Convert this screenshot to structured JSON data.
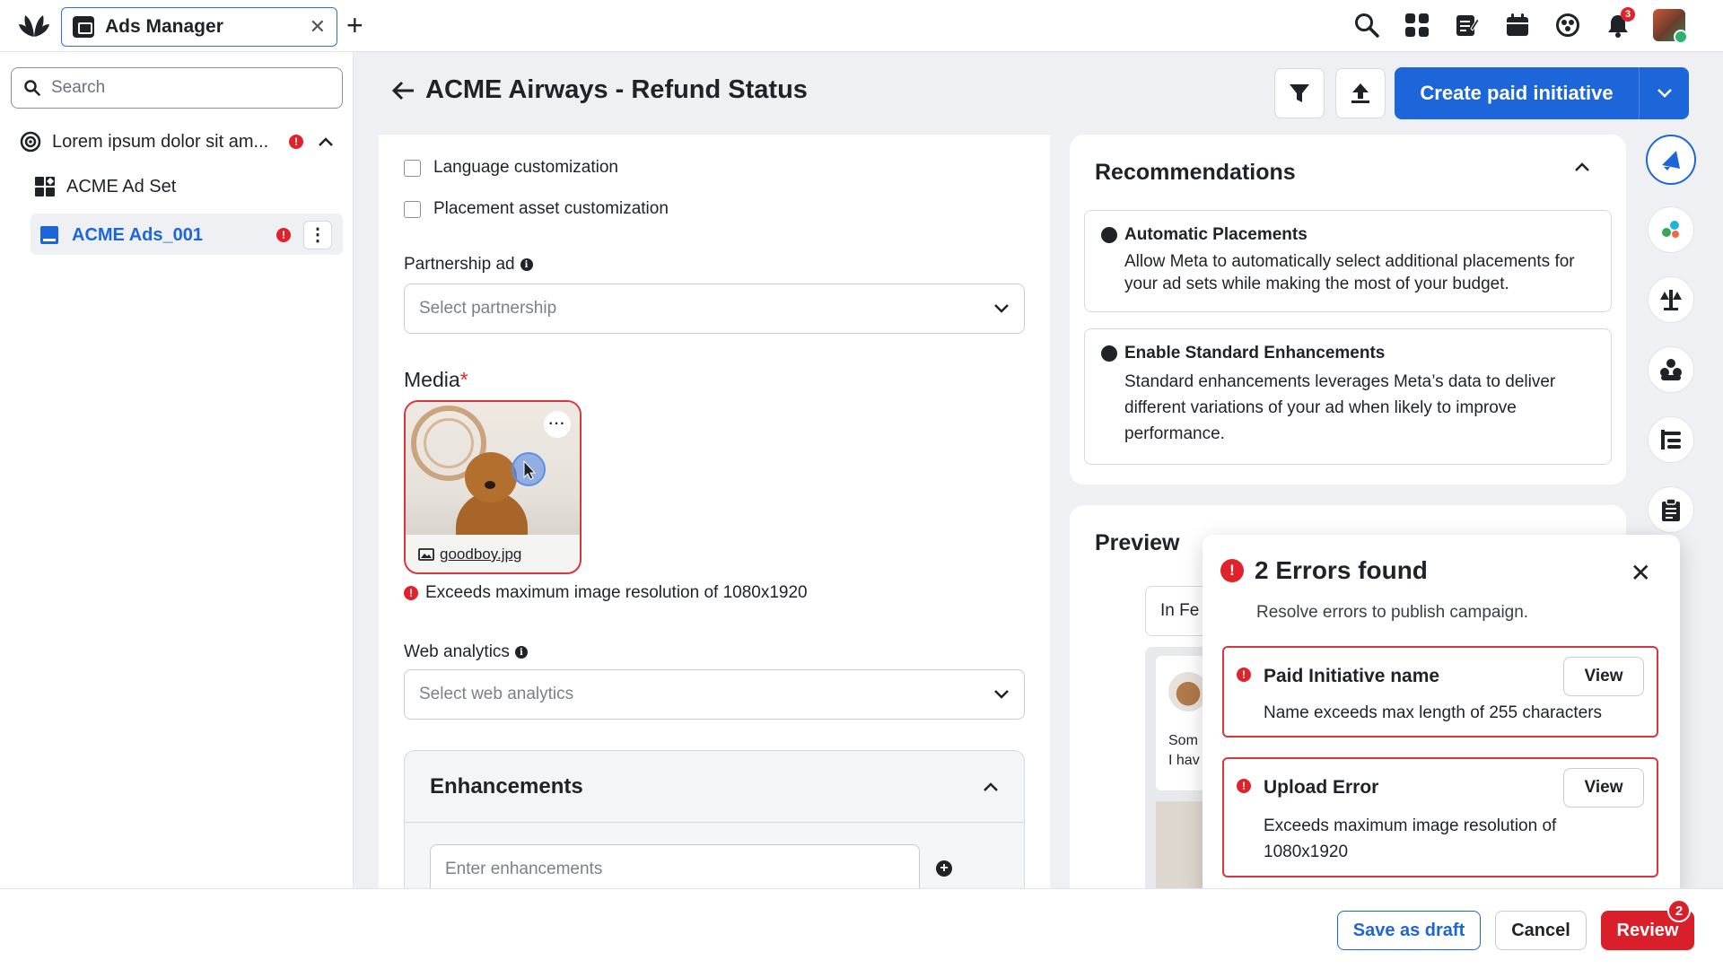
{
  "tab": {
    "title": "Ads Manager"
  },
  "topbar": {
    "notifications_count": "3"
  },
  "sidebar": {
    "search_placeholder": "Search",
    "campaign": "Lorem ipsum dolor sit am...",
    "ad_set": "ACME Ad Set",
    "ad": "ACME Ads_001",
    "error_mark": "!"
  },
  "header": {
    "title": "ACME Airways - Refund Status",
    "create_label": "Create paid initiative"
  },
  "form": {
    "language_customization": "Language customization",
    "placement_customization": "Placement asset customization",
    "partnership_label": "Partnership ad",
    "partnership_placeholder": "Select partnership",
    "media_label": "Media",
    "media_required": "*",
    "media_file": "goodboy.jpg",
    "media_error": "Exceeds maximum image resolution of 1080x1920",
    "web_analytics_label": "Web analytics",
    "web_analytics_placeholder": "Select web analytics",
    "enhancements_title": "Enhancements",
    "enhancements_placeholder": "Enter enhancements"
  },
  "recommendations": {
    "title": "Recommendations",
    "items": [
      {
        "title": "Automatic Placements",
        "body": "Allow Meta to automatically select additional placements for your ad sets while making the most of your budget."
      },
      {
        "title": "Enable Standard Enhancements",
        "body": "Standard enhancements leverages Meta’s data to deliver different variations of your ad when likely to improve performance."
      }
    ]
  },
  "preview": {
    "title": "Preview",
    "placement": "In Fe",
    "post_text_1": "Som",
    "post_text_2": "I hav"
  },
  "errors": {
    "title": "2 Errors found",
    "subtitle": "Resolve errors to publish campaign.",
    "items": [
      {
        "title": "Paid Initiative name",
        "body": "Name exceeds max length of 255 characters",
        "action": "View"
      },
      {
        "title": "Upload Error",
        "body": "Exceeds maximum image resolution of 1080x1920",
        "action": "View"
      }
    ]
  },
  "footer": {
    "save_draft": "Save as draft",
    "cancel": "Cancel",
    "review": "Review",
    "review_badge": "2"
  },
  "colors": {
    "primary": "#1d66d9",
    "error": "#e0222a",
    "background": "#eef0f3"
  }
}
